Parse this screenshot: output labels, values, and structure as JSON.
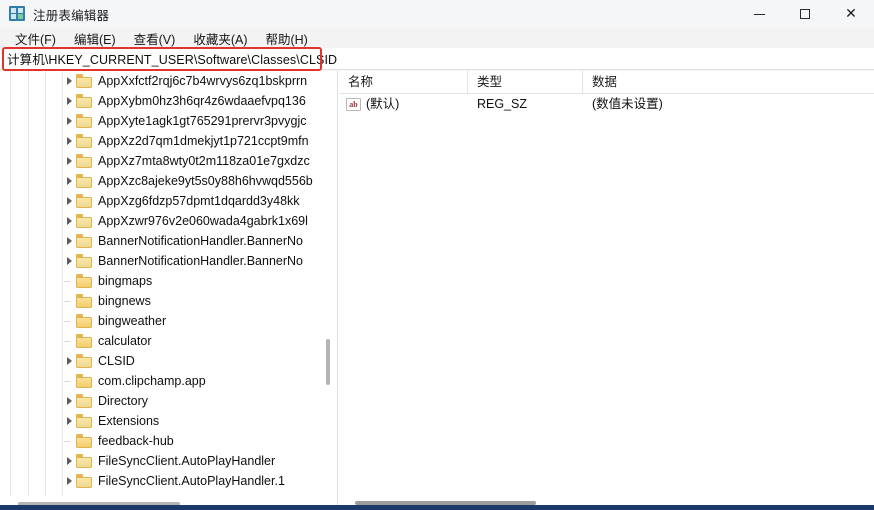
{
  "window": {
    "title": "注册表编辑器",
    "icon": "registry-editor-icon",
    "controls": {
      "minimize": "–",
      "maximize": "□",
      "close": "✕"
    }
  },
  "menu": {
    "items": [
      {
        "label": "文件(F)"
      },
      {
        "label": "编辑(E)"
      },
      {
        "label": "查看(V)"
      },
      {
        "label": "收藏夹(A)"
      },
      {
        "label": "帮助(H)"
      }
    ]
  },
  "address": {
    "path": "计算机\\HKEY_CURRENT_USER\\Software\\Classes\\CLSID",
    "highlight_color": "#e2342b"
  },
  "tree": {
    "items": [
      {
        "label": "AppXxfctf2rqj6c7b4wrvys6zq1bskprrn",
        "expandable": true,
        "selected": false
      },
      {
        "label": "AppXybm0hz3h6qr4z6wdaaefvpq136",
        "expandable": true,
        "selected": false
      },
      {
        "label": "AppXyte1agk1gt765291prervr3pvygjc",
        "expandable": true,
        "selected": false
      },
      {
        "label": "AppXz2d7qm1dmekjyt1p721ccpt9mfn",
        "expandable": true,
        "selected": false
      },
      {
        "label": "AppXz7mta8wty0t2m118za01e7gxdzc",
        "expandable": true,
        "selected": false
      },
      {
        "label": "AppXzc8ajeke9yt5s0y88h6hvwqd556b",
        "expandable": true,
        "selected": false
      },
      {
        "label": "AppXzg6fdzp57dpmt1dqardd3y48kk",
        "expandable": true,
        "selected": false
      },
      {
        "label": "AppXzwr976v2e060wada4gabrk1x69l",
        "expandable": true,
        "selected": false
      },
      {
        "label": "BannerNotificationHandler.BannerNo",
        "expandable": true,
        "selected": false
      },
      {
        "label": "BannerNotificationHandler.BannerNo",
        "expandable": true,
        "selected": false
      },
      {
        "label": "bingmaps",
        "expandable": false,
        "selected": false
      },
      {
        "label": "bingnews",
        "expandable": false,
        "selected": false
      },
      {
        "label": "bingweather",
        "expandable": false,
        "selected": false
      },
      {
        "label": "calculator",
        "expandable": false,
        "selected": false
      },
      {
        "label": "CLSID",
        "expandable": true,
        "selected": true
      },
      {
        "label": "com.clipchamp.app",
        "expandable": false,
        "selected": false
      },
      {
        "label": "Directory",
        "expandable": true,
        "selected": false
      },
      {
        "label": "Extensions",
        "expandable": true,
        "selected": false
      },
      {
        "label": "feedback-hub",
        "expandable": false,
        "selected": false
      },
      {
        "label": "FileSyncClient.AutoPlayHandler",
        "expandable": true,
        "selected": false
      },
      {
        "label": "FileSyncClient.AutoPlayHandler.1",
        "expandable": true,
        "selected": false
      }
    ]
  },
  "list": {
    "columns": [
      {
        "label": "名称"
      },
      {
        "label": "类型"
      },
      {
        "label": "数据"
      }
    ],
    "rows": [
      {
        "name": "(默认)",
        "type": "REG_SZ",
        "data": "(数值未设置)",
        "icon": "ab-string-icon",
        "icon_text": "ab"
      }
    ]
  }
}
